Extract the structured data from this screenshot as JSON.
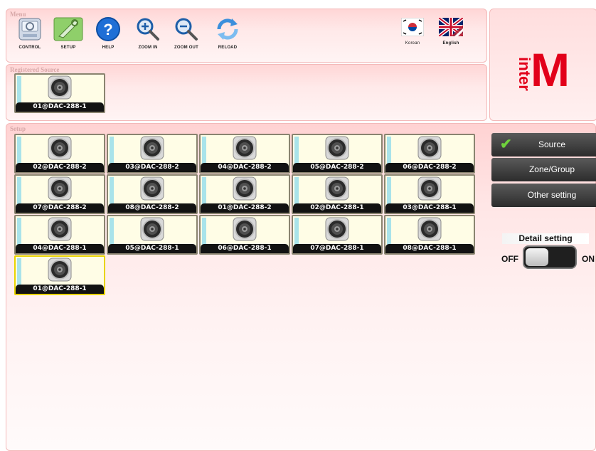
{
  "menu": {
    "title": "Menu",
    "tools": [
      {
        "label": "CONTROL",
        "icon": "control-panel-icon"
      },
      {
        "label": "SETUP",
        "icon": "setup-tools-icon"
      },
      {
        "label": "HELP",
        "icon": "help-icon"
      },
      {
        "label": "ZOOM IN",
        "icon": "zoom-in-icon"
      },
      {
        "label": "ZOOM OUT",
        "icon": "zoom-out-icon"
      },
      {
        "label": "RELOAD",
        "icon": "reload-icon"
      }
    ],
    "languages": [
      {
        "label": "Korean",
        "icon": "korea-flag-icon"
      },
      {
        "label": "English",
        "icon": "uk-us-flag-icon"
      }
    ]
  },
  "logo": {
    "text_vertical": "inter",
    "text_big": "M",
    "color": "#e2001a"
  },
  "registered": {
    "title": "Registered Source",
    "tiles": [
      "01@DAC-288-1"
    ]
  },
  "setup": {
    "title": "Setup",
    "tiles": [
      "02@DAC-288-2",
      "03@DAC-288-2",
      "04@DAC-288-2",
      "05@DAC-288-2",
      "06@DAC-288-2",
      "07@DAC-288-2",
      "08@DAC-288-2",
      "01@DAC-288-2",
      "02@DAC-288-1",
      "03@DAC-288-1",
      "04@DAC-288-1",
      "05@DAC-288-1",
      "06@DAC-288-1",
      "07@DAC-288-1",
      "08@DAC-288-1",
      "01@DAC-288-1"
    ],
    "selected_index": 15
  },
  "sidebar": {
    "buttons": [
      {
        "label": "Source",
        "checked": true
      },
      {
        "label": "Zone/Group",
        "checked": false
      },
      {
        "label": "Other setting",
        "checked": false
      }
    ],
    "detail_label": "Detail setting",
    "off_label": "OFF",
    "on_label": "ON",
    "detail_on": false
  }
}
